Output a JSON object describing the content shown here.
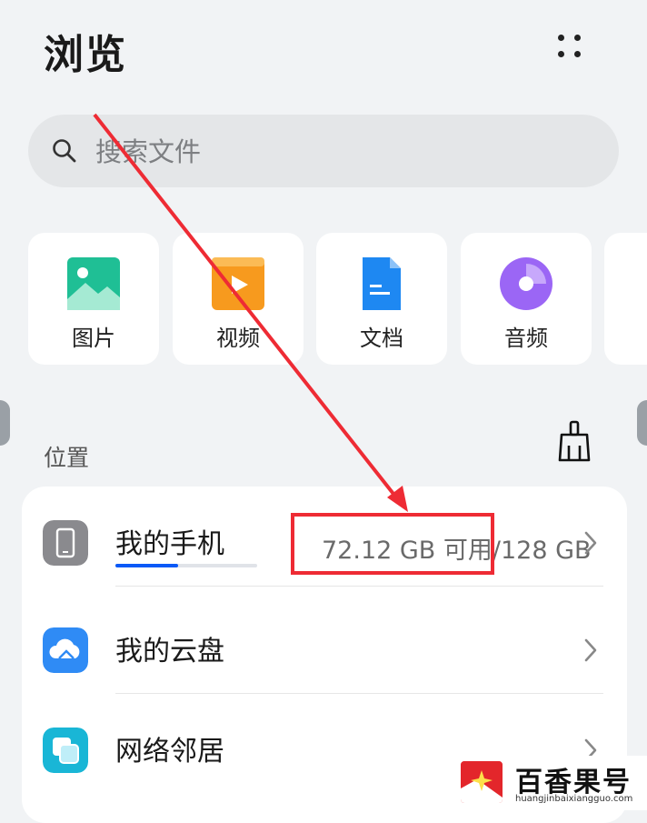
{
  "header": {
    "title": "浏览"
  },
  "search": {
    "placeholder": "搜索文件"
  },
  "categories": [
    {
      "label": "图片",
      "icon": "image-icon",
      "color": "#1fbf95"
    },
    {
      "label": "视频",
      "icon": "video-icon",
      "color": "#f79a1e"
    },
    {
      "label": "文档",
      "icon": "document-icon",
      "color": "#1e88f2"
    },
    {
      "label": "音频",
      "icon": "audio-icon",
      "color": "#9b66f5"
    }
  ],
  "locations": {
    "title": "位置",
    "items": [
      {
        "label": "我的手机",
        "icon": "phone-icon",
        "storage": "72.12 GB 可用/128 GB",
        "used_fraction": 0.44
      },
      {
        "label": "我的云盘",
        "icon": "cloud-icon"
      },
      {
        "label": "网络邻居",
        "icon": "network-icon"
      }
    ]
  },
  "watermark": {
    "name": "百香果号",
    "url": "huangjinbaixiangguo.com"
  },
  "colors": {
    "annotation": "#ee2b34",
    "accent": "#0a59f7"
  }
}
